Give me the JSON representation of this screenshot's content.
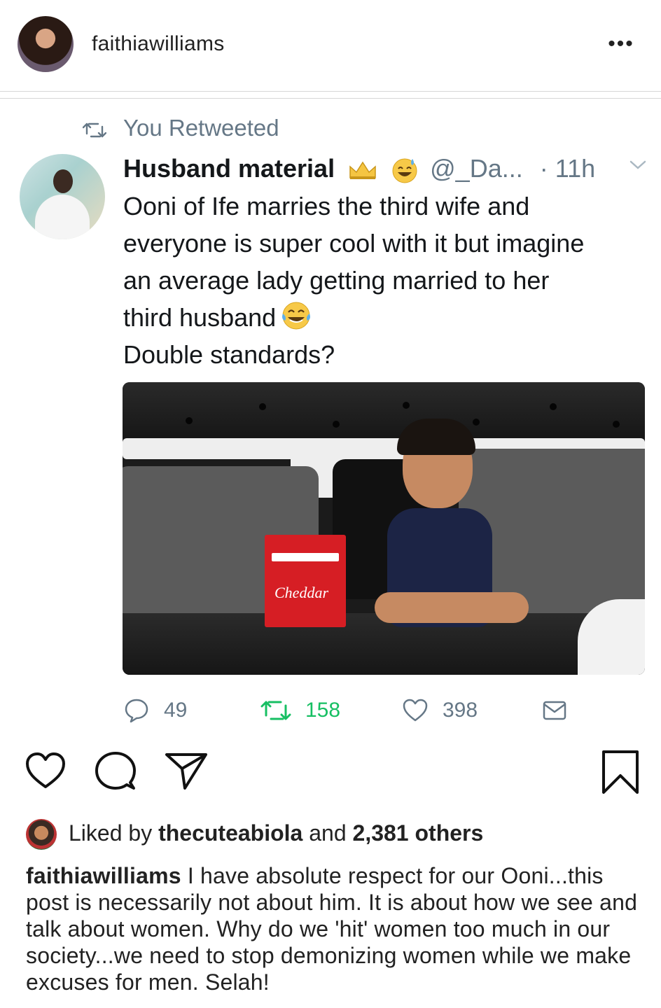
{
  "post": {
    "username": "faithiawilliams",
    "more_label": "•••"
  },
  "tweet": {
    "retweet_label": "You Retweeted",
    "author_name": "Husband material",
    "handle": "@_Da...",
    "time": "· 11h",
    "lines": [
      "Ooni of Ife marries the third wife and",
      "everyone is super cool with it but imagine",
      "an average lady getting married to her",
      "third husband",
      "Double standards?"
    ],
    "image_box_text": "Cheddar",
    "replies": "49",
    "retweets": "158",
    "likes": "398",
    "colors": {
      "retweet": "#17bf63",
      "meta": "#657786"
    }
  },
  "likes": {
    "prefix": "Liked by",
    "user": "thecuteabiola",
    "middle": "and",
    "others": "2,381 others"
  },
  "caption": {
    "username": "faithiawilliams",
    "text": "I have absolute respect for our Ooni...this post is necessarily not about him. It is about how we see and talk about women. Why do we 'hit' women too much in our society...we need to stop demonizing women while we make excuses for men. Selah!"
  },
  "icons": [
    "retweet-icon",
    "reply-icon",
    "heart-icon",
    "mail-icon",
    "comment-icon",
    "share-icon",
    "bookmark-icon",
    "caret-down-icon"
  ]
}
